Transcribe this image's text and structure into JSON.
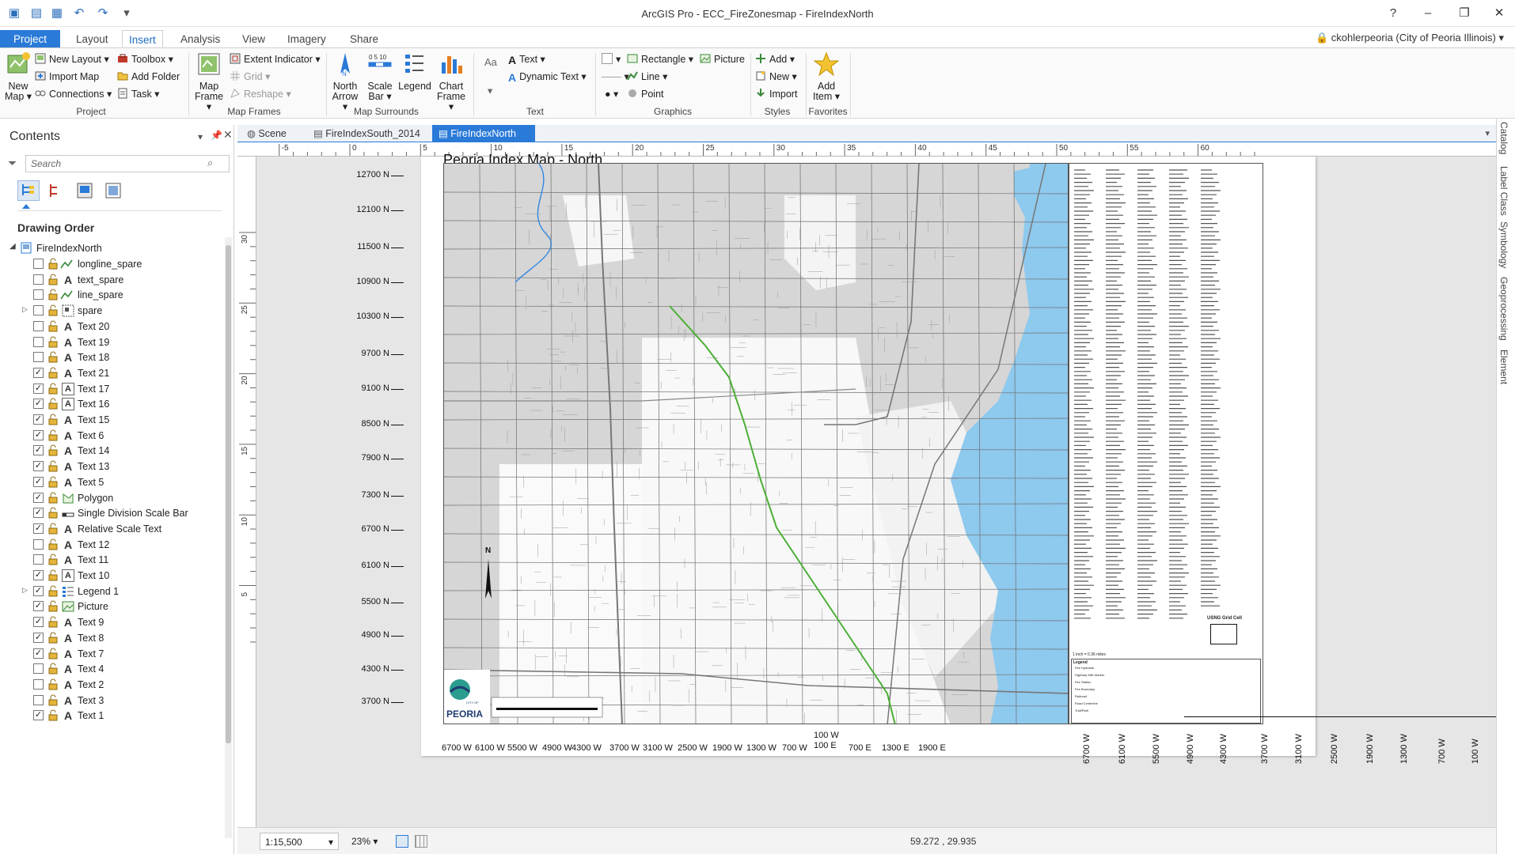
{
  "window": {
    "title": "ArcGIS Pro - ECC_FireZonesmap - FireIndexNorth",
    "help": "?",
    "minimize": "–",
    "restore": "❐",
    "close": "✕"
  },
  "user": "ckohlerpeoria (City of Peoria Illinois)",
  "ribbon_tabs": [
    "Project",
    "Layout",
    "Insert",
    "Analysis",
    "View",
    "Imagery",
    "Share"
  ],
  "active_tab": "Insert",
  "ribbon": {
    "project": {
      "new_map": "New Map",
      "new_layout": "New Layout",
      "import_map": "Import Map",
      "connections": "Connections",
      "toolbox": "Toolbox",
      "add_folder": "Add Folder",
      "task": "Task",
      "label": "Project"
    },
    "map_frames": {
      "map_frame": "Map Frame",
      "extent_indicator": "Extent Indicator",
      "grid": "Grid",
      "reshape": "Reshape",
      "label": "Map Frames"
    },
    "map_surrounds": {
      "north_arrow": "North Arrow",
      "scale_bar": "Scale Bar",
      "legend": "Legend",
      "chart_frame": "Chart Frame",
      "label": "Map Surrounds"
    },
    "text": {
      "aa": "Aa",
      "text": "Text",
      "dynamic_text": "Dynamic Text",
      "label": "Text"
    },
    "graphics": {
      "rectangle": "Rectangle",
      "picture": "Picture",
      "line": "Line",
      "point": "Point",
      "label": "Graphics"
    },
    "styles": {
      "add": "Add",
      "new": "New",
      "import": "Import",
      "label": "Styles"
    },
    "favorites": {
      "add_item": "Add Item",
      "label": "Favorites"
    }
  },
  "contents": {
    "title": "Contents",
    "search_placeholder": "Search",
    "drawing_order": "Drawing Order",
    "root": "FireIndexNorth",
    "layers": [
      {
        "name": "longline_spare",
        "checked": false,
        "icon": "line-icon",
        "expandable": false
      },
      {
        "name": "text_spare",
        "checked": false,
        "icon": "text-icon",
        "expandable": false
      },
      {
        "name": "line_spare",
        "checked": false,
        "icon": "line-icon",
        "expandable": false
      },
      {
        "name": "spare",
        "checked": false,
        "icon": "group-icon",
        "expandable": true
      },
      {
        "name": "Text 20",
        "checked": false,
        "icon": "text-icon",
        "expandable": false
      },
      {
        "name": "Text 19",
        "checked": false,
        "icon": "text-icon",
        "expandable": false
      },
      {
        "name": "Text 18",
        "checked": false,
        "icon": "text-icon",
        "expandable": false
      },
      {
        "name": "Text 21",
        "checked": true,
        "icon": "text-icon",
        "expandable": false
      },
      {
        "name": "Text 17",
        "checked": true,
        "icon": "text-box-icon",
        "expandable": false
      },
      {
        "name": "Text 16",
        "checked": true,
        "icon": "text-box-icon",
        "expandable": false
      },
      {
        "name": "Text 15",
        "checked": true,
        "icon": "text-icon",
        "expandable": false
      },
      {
        "name": "Text 6",
        "checked": true,
        "icon": "text-icon",
        "expandable": false
      },
      {
        "name": "Text 14",
        "checked": true,
        "icon": "text-icon",
        "expandable": false
      },
      {
        "name": "Text 13",
        "checked": true,
        "icon": "text-icon",
        "expandable": false
      },
      {
        "name": "Text 5",
        "checked": true,
        "icon": "text-icon",
        "expandable": false
      },
      {
        "name": "Polygon",
        "checked": true,
        "icon": "polygon-icon",
        "expandable": false
      },
      {
        "name": "Single Division Scale Bar",
        "checked": true,
        "icon": "scalebar-icon",
        "expandable": false
      },
      {
        "name": "Relative Scale Text",
        "checked": true,
        "icon": "text-icon",
        "expandable": false
      },
      {
        "name": "Text 12",
        "checked": false,
        "icon": "text-icon",
        "expandable": false
      },
      {
        "name": "Text 11",
        "checked": false,
        "icon": "text-icon",
        "expandable": false
      },
      {
        "name": "Text 10",
        "checked": true,
        "icon": "text-box-icon",
        "expandable": false
      },
      {
        "name": "Legend 1",
        "checked": true,
        "icon": "legend-icon",
        "expandable": true
      },
      {
        "name": "Picture",
        "checked": true,
        "icon": "picture-icon",
        "expandable": false
      },
      {
        "name": "Text 9",
        "checked": true,
        "icon": "text-icon",
        "expandable": false
      },
      {
        "name": "Text 8",
        "checked": true,
        "icon": "text-icon",
        "expandable": false
      },
      {
        "name": "Text 7",
        "checked": true,
        "icon": "text-icon",
        "expandable": false
      },
      {
        "name": "Text 4",
        "checked": false,
        "icon": "text-icon",
        "expandable": false
      },
      {
        "name": "Text 2",
        "checked": false,
        "icon": "text-icon",
        "expandable": false
      },
      {
        "name": "Text 3",
        "checked": false,
        "icon": "text-icon",
        "expandable": false
      },
      {
        "name": "Text 1",
        "checked": true,
        "icon": "text-icon",
        "expandable": false
      }
    ]
  },
  "doc_tabs": [
    "Scene",
    "FireIndexSouth_2014",
    "FireIndexNorth"
  ],
  "active_doc_tab": "FireIndexNorth",
  "ruler_h": [
    "-5",
    "0",
    "5",
    "10",
    "15",
    "20",
    "25",
    "30",
    "35",
    "40",
    "45",
    "50",
    "55",
    "60"
  ],
  "ruler_v": [
    "30",
    "25",
    "20",
    "15",
    "10",
    "5"
  ],
  "layout": {
    "map_title": "Peoria Index Map - North",
    "n_labels": [
      "12700 N",
      "12100 N",
      "11500 N",
      "10900 N",
      "10300 N",
      "9700 N",
      "9100 N",
      "8500 N",
      "7900 N",
      "7300 N",
      "6700 N",
      "6100 N",
      "5500 N",
      "4900 N",
      "4300 N",
      "3700 N"
    ],
    "w_labels_bottom": [
      "6700 W",
      "6100 W",
      "5500 W",
      "4900 W",
      "4300 W",
      "3700 W",
      "3100 W",
      "2500 W",
      "1900 W",
      "1300 W",
      "700 W",
      "100 W",
      "100 E",
      "700 E",
      "1300 E",
      "1900 E"
    ],
    "w_labels_vertical": [
      "6700 W",
      "6100 W",
      "5500 W",
      "4900 W",
      "4300 W",
      "3700 W",
      "3100 W",
      "2500 W",
      "1900 W",
      "1300 W",
      "700 W",
      "100 W"
    ],
    "north": "N",
    "logo_text": "PEORIA",
    "logo_small": "CITY OF",
    "scale_text": "1 inch = 0.36 miles",
    "usng": "USNG Grid Cell",
    "legend_title": "Legend",
    "legend_items": [
      "Fire Hydrants",
      "Highway Mile Marker",
      "Fire Station",
      "Fire Boundary",
      "Railroad",
      "Road Centerline",
      "Trail/Path"
    ]
  },
  "status": {
    "scale": "1:15,500",
    "zoom": "23%",
    "coords": "59.272 , 29.935"
  },
  "right_panes": [
    "Catalog",
    "Label Class",
    "Symbology",
    "Geoprocessing",
    "Element"
  ],
  "colors": {
    "accent": "#2a7ad8",
    "water": "#8ec9ee",
    "map_grey": "#d9d9d9",
    "trail": "#4caf36"
  }
}
